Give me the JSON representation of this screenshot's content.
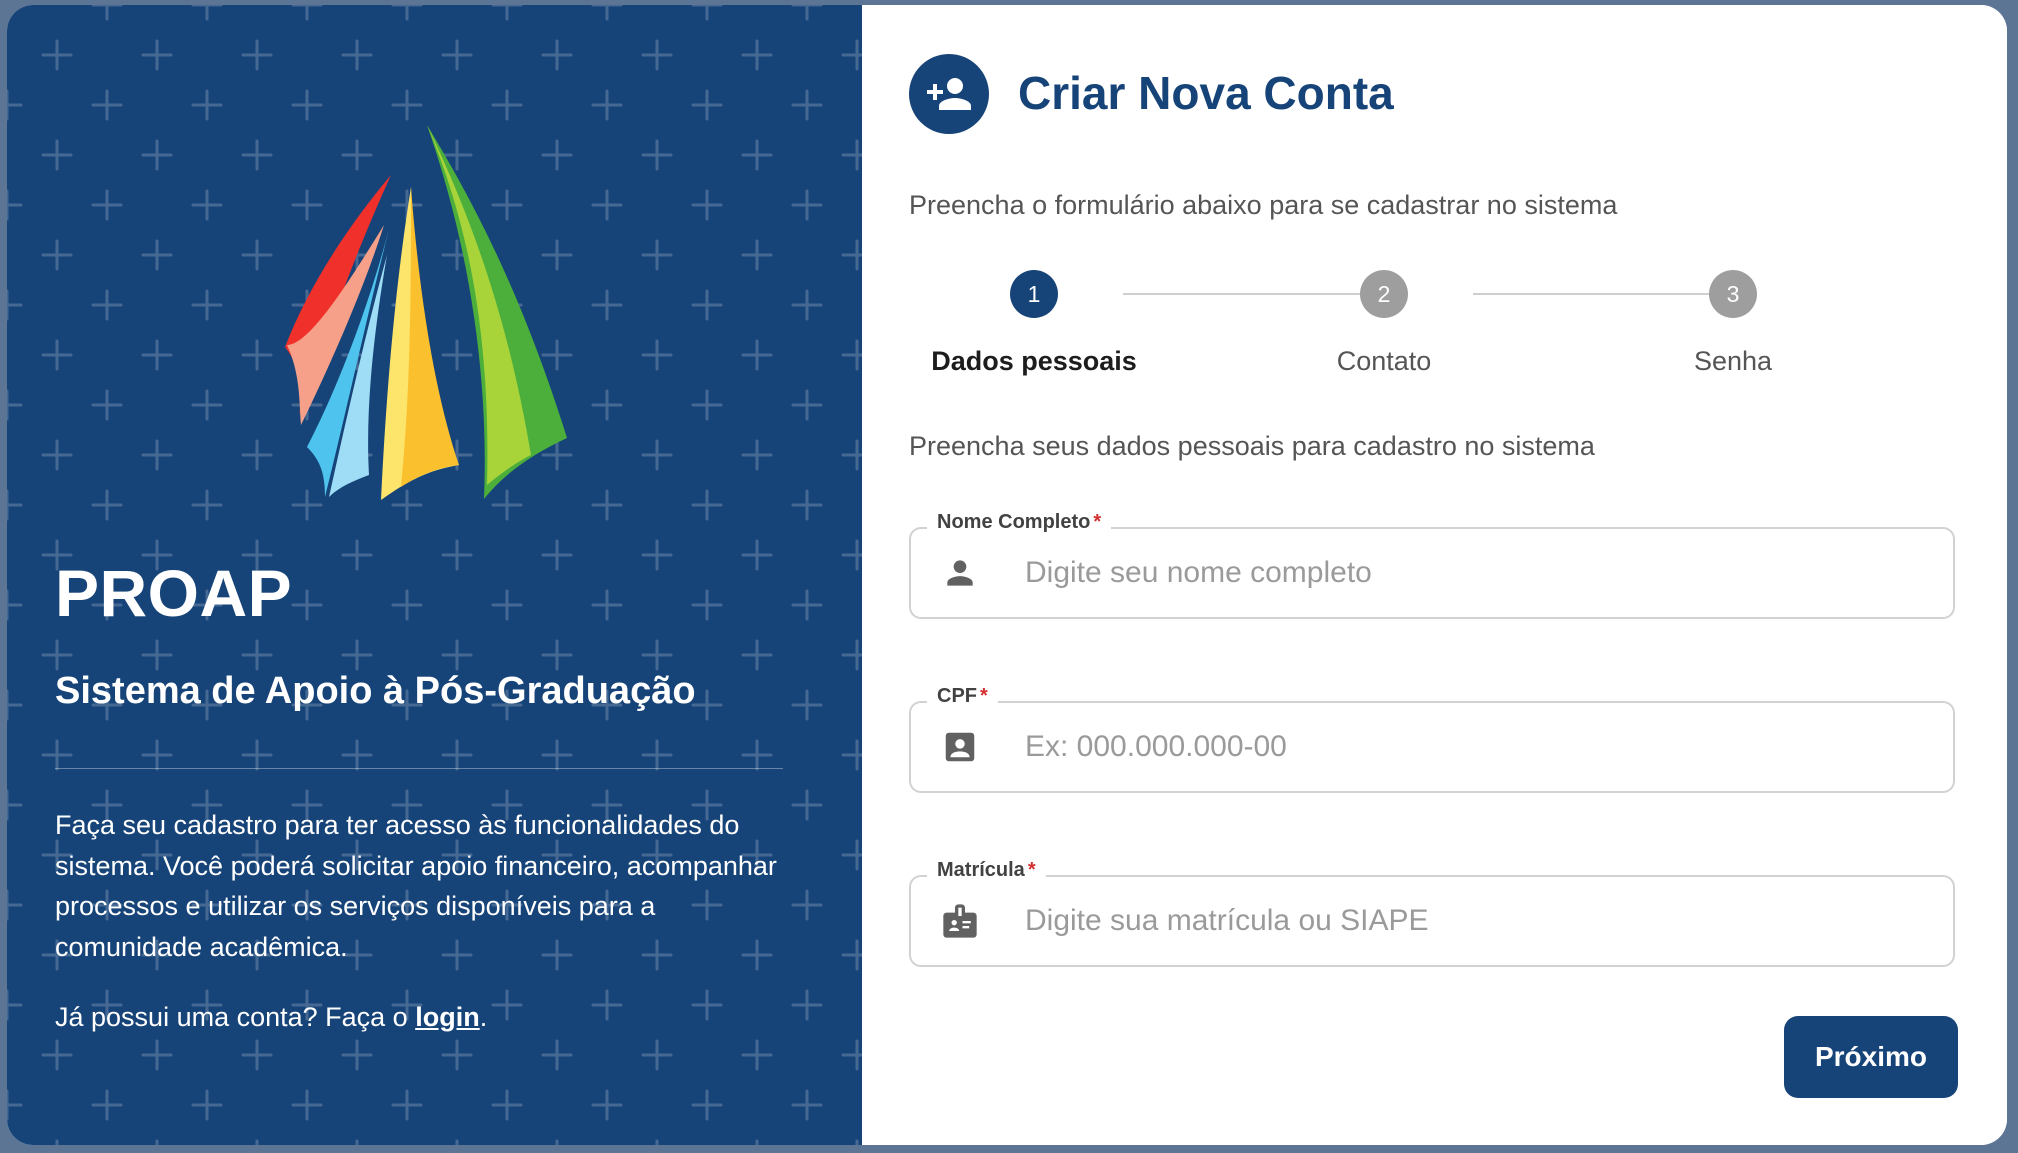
{
  "brand": {
    "title": "PROAP",
    "subtitle": "Sistema de Apoio à Pós-Graduação",
    "description": "Faça seu cadastro para ter acesso às funcionalidades do sistema. Você poderá solicitar apoio financeiro, acompanhar processos e utilizar os serviços disponíveis para a comunidade acadêmica.",
    "login_prefix": "Já possui uma conta? Faça o ",
    "login_link": "login",
    "login_suffix": "."
  },
  "header": {
    "title": "Criar Nova Conta",
    "subtitle": "Preencha o formulário abaixo para se cadastrar no sistema",
    "icon": "person-add-icon"
  },
  "stepper": {
    "steps": [
      {
        "number": "1",
        "label": "Dados pessoais",
        "active": true
      },
      {
        "number": "2",
        "label": "Contato",
        "active": false
      },
      {
        "number": "3",
        "label": "Senha",
        "active": false
      }
    ]
  },
  "form": {
    "section_text": "Preencha seus dados pessoais para cadastro no sistema",
    "required_mark": "*",
    "fields": [
      {
        "label": "Nome Completo",
        "placeholder": "Digite seu nome completo",
        "value": "",
        "icon": "person-icon"
      },
      {
        "label": "CPF",
        "placeholder": "Ex: 000.000.000-00",
        "value": "",
        "icon": "id-card-icon"
      },
      {
        "label": "Matrícula",
        "placeholder": "Digite sua matrícula ou SIAPE",
        "value": "",
        "icon": "badge-icon"
      }
    ]
  },
  "actions": {
    "next_label": "Próximo"
  },
  "colors": {
    "primary": "#174478",
    "required": "#d32f2f",
    "step_inactive": "#9e9e9e"
  }
}
